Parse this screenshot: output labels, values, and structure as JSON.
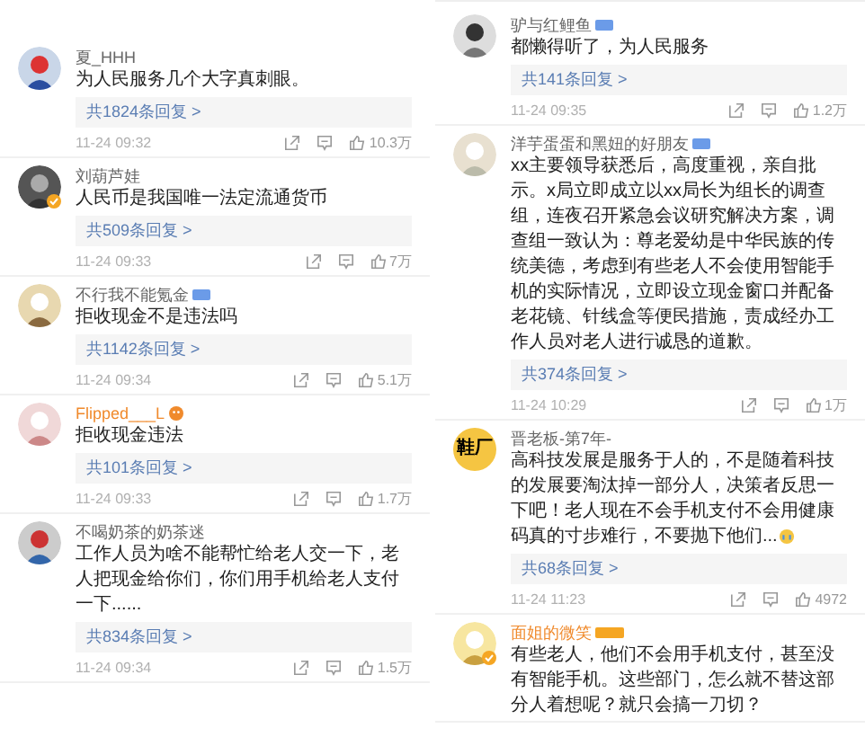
{
  "columns": [
    {
      "comments": [
        {
          "avatar": {
            "kind": "picture",
            "verified": false
          },
          "name": "夏_HHH",
          "highlighted": false,
          "text": "为人民服务几个大字真刺眼。",
          "replies": "共1824条回复 >",
          "time": "11-24 09:32",
          "likes": "10.3万"
        },
        {
          "avatar": {
            "kind": "picture",
            "verified": true
          },
          "name": "刘葫芦娃",
          "highlighted": false,
          "text": "人民币是我国唯一法定流通货币",
          "replies": "共509条回复 >",
          "time": "11-24 09:33",
          "likes": "7万"
        },
        {
          "avatar": {
            "kind": "picture",
            "verified": false
          },
          "name": "不行我不能氪金",
          "highlighted": false,
          "badge": {
            "kind": "level"
          },
          "text": "拒收现金不是违法吗",
          "replies": "共1142条回复 >",
          "time": "11-24 09:34",
          "likes": "5.1万"
        },
        {
          "avatar": {
            "kind": "picture",
            "verified": false
          },
          "name": "Flipped___L",
          "highlighted": true,
          "badge": {
            "kind": "emoji"
          },
          "text": "拒收现金违法",
          "replies": "共101条回复 >",
          "time": "11-24 09:33",
          "likes": "1.7万"
        },
        {
          "avatar": {
            "kind": "picture",
            "verified": false
          },
          "name": "不喝奶茶的奶茶迷",
          "highlighted": false,
          "text": "工作人员为啥不能帮忙给老人交一下，老人把现金给你们，你们用手机给老人支付一下......",
          "replies": "共834条回复 >",
          "time": "11-24 09:34",
          "likes": "1.5万"
        }
      ]
    },
    {
      "comments": [
        {
          "avatar": {
            "kind": "picture",
            "verified": false
          },
          "name": "驴与红鲤鱼",
          "highlighted": false,
          "badge": {
            "kind": "level"
          },
          "text": "都懒得听了，为人民服务",
          "replies": "共141条回复 >",
          "time": "11-24 09:35",
          "likes": "1.2万"
        },
        {
          "avatar": {
            "kind": "picture",
            "verified": false
          },
          "name": "洋芋蛋蛋和黑妞的好朋友",
          "highlighted": false,
          "badge": {
            "kind": "level"
          },
          "text": "xx主要领导获悉后，高度重视，亲自批示。x局立即成立以xx局长为组长的调查组，连夜召开紧急会议研究解决方案，调查组一致认为：尊老爱幼是中华民族的传统美德，考虑到有些老人不会使用智能手机的实际情况，立即设立现金窗口并配备老花镜、针线盒等便民措施，责成经办工作人员对老人进行诚恳的道歉。",
          "replies": "共374条回复 >",
          "time": "11-24 10:29",
          "likes": "1万"
        },
        {
          "avatar": {
            "kind": "text",
            "text": "鞋厂",
            "verified": false
          },
          "name": "晋老板-第7年-",
          "highlighted": false,
          "text": "高科技发展是服务于人的，不是随着科技的发展要淘汰掉一部分人，决策者反思一下吧！老人现在不会手机支付不会用健康码真的寸步难行，不要抛下他们...",
          "trailing_emoji": true,
          "replies": "共68条回复 >",
          "time": "11-24 11:23",
          "likes": "4972"
        },
        {
          "avatar": {
            "kind": "picture",
            "verified": true
          },
          "name": "面姐的微笑",
          "highlighted": true,
          "badge": {
            "kind": "member"
          },
          "text": "有些老人，他们不会用手机支付，甚至没有智能手机。这些部门，怎么就不替这部分人着想呢？就只会搞一刀切？"
        }
      ]
    }
  ]
}
